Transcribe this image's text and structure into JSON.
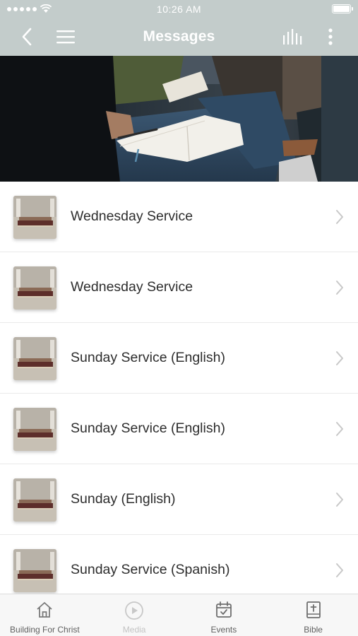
{
  "status_bar": {
    "time": "10:26 AM"
  },
  "nav": {
    "title": "Messages",
    "icons": [
      "back-chevron-icon",
      "hamburger-menu-icon",
      "audio-bars-icon",
      "more-vertical-icon"
    ]
  },
  "messages": [
    {
      "title": "Wednesday Service"
    },
    {
      "title": "Wednesday Service"
    },
    {
      "title": "Sunday Service (English)"
    },
    {
      "title": "Sunday Service (English)"
    },
    {
      "title": "Sunday (English)"
    },
    {
      "title": "Sunday Service (Spanish)"
    }
  ],
  "tabbar": {
    "tabs": [
      {
        "label": "Building For Christ",
        "icon": "home-icon",
        "active": true
      },
      {
        "label": "Media",
        "icon": "play-circle-icon",
        "active": false
      },
      {
        "label": "Events",
        "icon": "calendar-check-icon",
        "active": true
      },
      {
        "label": "Bible",
        "icon": "bible-cross-icon",
        "active": true
      }
    ]
  },
  "colors": {
    "nav_background": "#c3cccb",
    "tab_text": "#5f5f5f",
    "tab_text_disabled": "#c3c3c3"
  }
}
